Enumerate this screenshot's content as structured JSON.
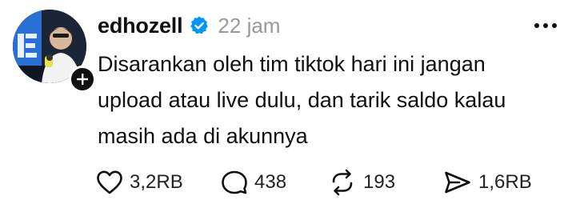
{
  "post": {
    "username": "edhozell",
    "timestamp": "22 jam",
    "body_lines": [
      "Disarankan oleh tim tiktok hari ini jangan",
      "upload atau live dulu, dan tarik saldo kalau",
      "masih ada di akunnya"
    ],
    "verified": true,
    "avatar_icon": "user-avatar",
    "follow_icon": "plus-icon",
    "more_icon": "more-horizontal-icon"
  },
  "actions": {
    "like": {
      "icon": "heart-icon",
      "count": "3,2RB"
    },
    "reply": {
      "icon": "comment-icon",
      "count": "438"
    },
    "repost": {
      "icon": "repost-icon",
      "count": "193"
    },
    "share": {
      "icon": "send-icon",
      "count": "1,6RB"
    }
  },
  "colors": {
    "text": "#101010",
    "muted": "#999999",
    "verified_blue": "#0095f6",
    "background": "#ffffff"
  }
}
